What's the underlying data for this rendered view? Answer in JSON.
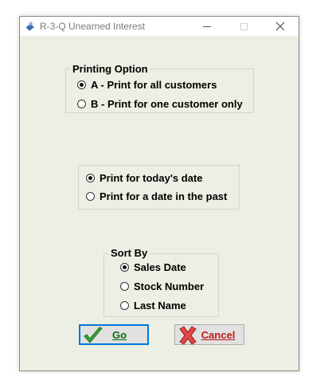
{
  "window": {
    "title": "R-3-Q  Unearned Interest"
  },
  "printing_option": {
    "legend": "Printing Option",
    "options": [
      {
        "label": "A - Print for all customers",
        "checked": true
      },
      {
        "label": "B - Print for one customer only",
        "checked": false
      }
    ]
  },
  "date_option": {
    "options": [
      {
        "label": "Print for today's date",
        "checked": true
      },
      {
        "label": "Print for a date in the past",
        "checked": false
      }
    ]
  },
  "sort_by": {
    "legend": "Sort By",
    "options": [
      {
        "label": "Sales Date",
        "checked": true
      },
      {
        "label": "Stock Number",
        "checked": false
      },
      {
        "label": "Last Name",
        "checked": false
      }
    ]
  },
  "buttons": {
    "go_label": "Go",
    "cancel_label": "Cancel",
    "go_icon": "checkmark-icon",
    "cancel_icon": "x-icon"
  },
  "colors": {
    "go_accent": "#0a6a0a",
    "cancel_accent": "#c01818",
    "focus_border": "#0078d7",
    "window_bg": "#ecefe3"
  }
}
